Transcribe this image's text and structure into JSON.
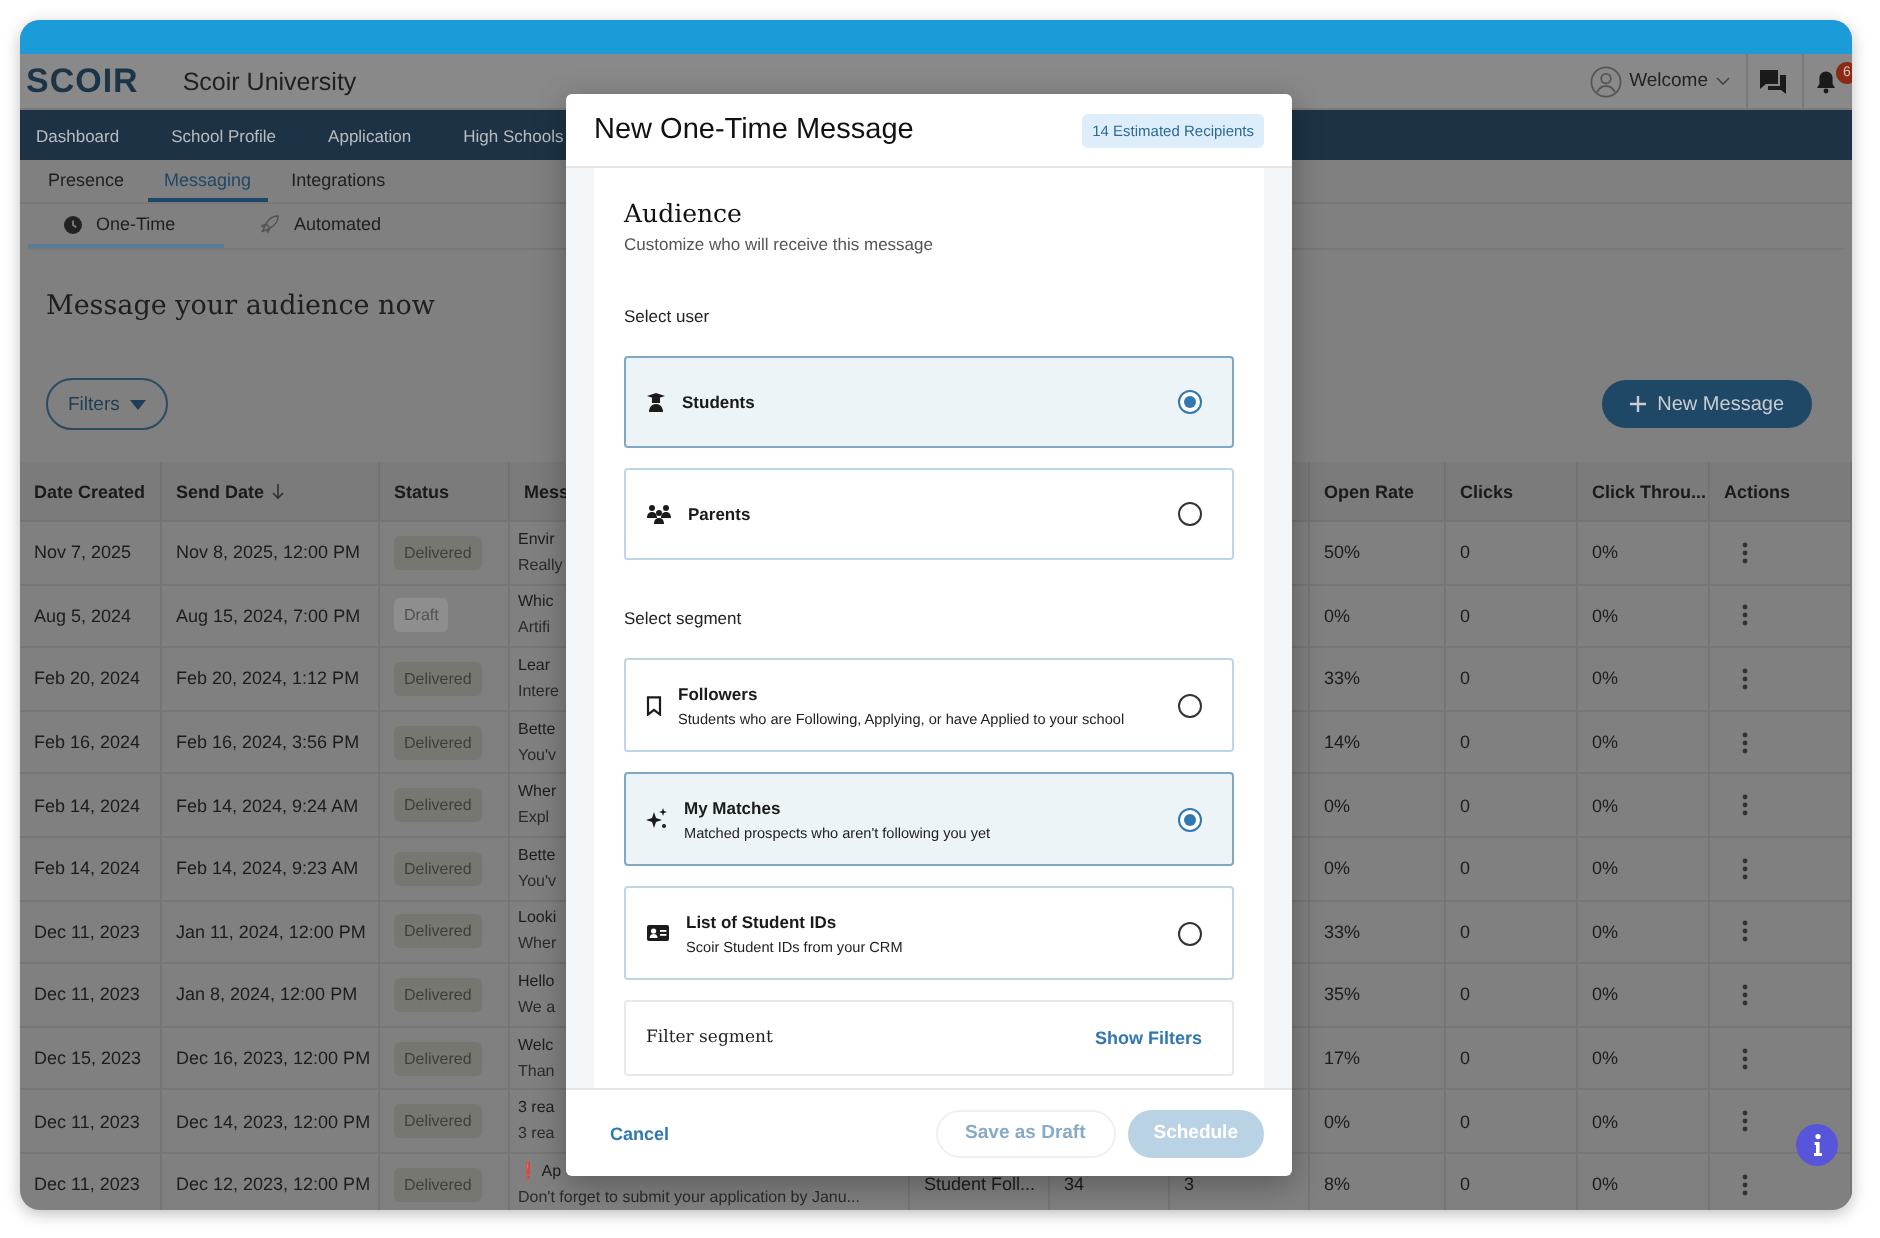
{
  "app": {
    "logo": "SCOIR",
    "school": "Scoir University",
    "user_menu": "Welcome",
    "notification_count": "6"
  },
  "nav": [
    {
      "label": "Dashboard",
      "selected": false
    },
    {
      "label": "School Profile",
      "selected": false
    },
    {
      "label": "Application",
      "selected": false
    },
    {
      "label": "High Schools",
      "selected": false
    }
  ],
  "subtabs": [
    {
      "label": "Presence",
      "selected": false
    },
    {
      "label": "Messaging",
      "selected": true
    },
    {
      "label": "Integrations",
      "selected": false
    }
  ],
  "message_tabs": [
    {
      "label": "One-Time",
      "selected": true
    },
    {
      "label": "Automated",
      "selected": false
    }
  ],
  "heading": "Message your audience now",
  "filters_button": "Filters",
  "new_message_button": "New Message",
  "table": {
    "columns": [
      "Date Created",
      "Send Date",
      "Status",
      "Mess",
      "Open Rate",
      "Clicks",
      "Click Throu...",
      "Actions"
    ],
    "rows": [
      {
        "created": "Nov 7, 2025",
        "sent": "Nov 8, 2025, 12:00 PM",
        "status": {
          "label": "Delivered",
          "kind": "delivered"
        },
        "title": "Envir",
        "preview": "Really",
        "open_rate": "50%",
        "clicks": "0",
        "ctr": "0%"
      },
      {
        "created": "Aug 5, 2024",
        "sent": "Aug 15, 2024, 7:00 PM",
        "status": {
          "label": "Draft",
          "kind": "draft"
        },
        "title": "Whic",
        "preview": "Artifi",
        "open_rate": "0%",
        "clicks": "0",
        "ctr": "0%"
      },
      {
        "created": "Feb 20, 2024",
        "sent": "Feb 20, 2024, 1:12 PM",
        "status": {
          "label": "Delivered",
          "kind": "delivered"
        },
        "title": "Lear",
        "preview": "Intere",
        "open_rate": "33%",
        "clicks": "0",
        "ctr": "0%"
      },
      {
        "created": "Feb 16, 2024",
        "sent": "Feb 16, 2024, 3:56 PM",
        "status": {
          "label": "Delivered",
          "kind": "delivered"
        },
        "title": "Bette",
        "preview": "You'v",
        "open_rate": "14%",
        "clicks": "0",
        "ctr": "0%"
      },
      {
        "created": "Feb 14, 2024",
        "sent": "Feb 14, 2024, 9:24 AM",
        "status": {
          "label": "Delivered",
          "kind": "delivered"
        },
        "title": "Wher",
        "preview": "Expl",
        "open_rate": "0%",
        "clicks": "0",
        "ctr": "0%"
      },
      {
        "created": "Feb 14, 2024",
        "sent": "Feb 14, 2024, 9:23 AM",
        "status": {
          "label": "Delivered",
          "kind": "delivered"
        },
        "title": "Bette",
        "preview": "You'v",
        "open_rate": "0%",
        "clicks": "0",
        "ctr": "0%"
      },
      {
        "created": "Dec 11, 2023",
        "sent": "Jan 11, 2024, 12:00 PM",
        "status": {
          "label": "Delivered",
          "kind": "delivered"
        },
        "title": "Looki",
        "preview": "Wher",
        "open_rate": "33%",
        "clicks": "0",
        "ctr": "0%"
      },
      {
        "created": "Dec 11, 2023",
        "sent": "Jan 8, 2024, 12:00 PM",
        "status": {
          "label": "Delivered",
          "kind": "delivered"
        },
        "title": "Hello",
        "preview": "We a",
        "open_rate": "35%",
        "clicks": "0",
        "ctr": "0%"
      },
      {
        "created": "Dec 15, 2023",
        "sent": "Dec 16, 2023, 12:00 PM",
        "status": {
          "label": "Delivered",
          "kind": "delivered"
        },
        "title": "Welc",
        "preview": "Than",
        "open_rate": "17%",
        "clicks": "0",
        "ctr": "0%"
      },
      {
        "created": "Dec 11, 2023",
        "sent": "Dec 14, 2023, 12:00 PM",
        "status": {
          "label": "Delivered",
          "kind": "delivered"
        },
        "title": "3 rea",
        "preview": "3 rea",
        "open_rate": "0%",
        "clicks": "0",
        "ctr": "0%"
      },
      {
        "created": "Dec 11, 2023",
        "sent": "Dec 12, 2023, 12:00 PM",
        "status": {
          "label": "Delivered",
          "kind": "delivered"
        },
        "title": "❗ Ap",
        "preview": "Don't forget to submit your application by Janu...",
        "column_5": "Student Foll...",
        "column_6": "34",
        "column_7": "3",
        "open_rate": "8%",
        "clicks": "0",
        "ctr": "0%"
      }
    ]
  },
  "modal": {
    "title": "New One-Time Message",
    "recipients": "14 Estimated Recipients",
    "section_title": "Audience",
    "section_subtitle": "Customize who will receive this message",
    "user_label": "Select user",
    "users": [
      {
        "label": "Students",
        "selected": true
      },
      {
        "label": "Parents",
        "selected": false
      }
    ],
    "segment_label": "Select segment",
    "segments": [
      {
        "title": "Followers",
        "description": "Students who are Following, Applying, or have Applied to your school",
        "selected": false
      },
      {
        "title": "My Matches",
        "description": "Matched prospects who aren't following you yet",
        "selected": true
      },
      {
        "title": "List of Student IDs",
        "description": "Scoir Student IDs from your CRM",
        "selected": false
      }
    ],
    "filter": {
      "label": "Filter segment",
      "action": "Show Filters"
    },
    "cancel": "Cancel",
    "save_draft": {
      "label": "Save as Draft",
      "disabled": true
    },
    "schedule": {
      "label": "Schedule",
      "disabled": true
    }
  }
}
